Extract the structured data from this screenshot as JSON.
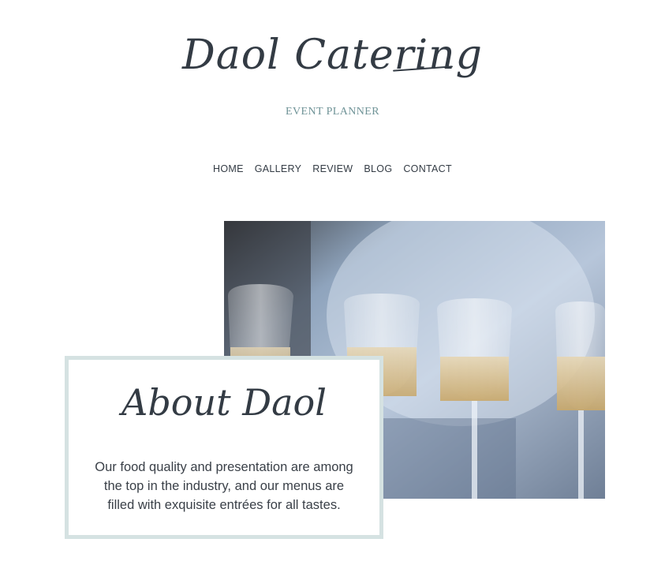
{
  "header": {
    "logo_text": "Daol Catering",
    "tagline": "EVENT PLANNER"
  },
  "nav": {
    "items": [
      {
        "label": "HOME"
      },
      {
        "label": "GALLERY"
      },
      {
        "label": "REVIEW"
      },
      {
        "label": "BLOG"
      },
      {
        "label": "CONTACT"
      }
    ]
  },
  "hero": {
    "image_description_icon": "champagne-glasses-photo"
  },
  "about": {
    "title": "About Daol",
    "body": "Our food quality and presentation are among the top in the industry, and our menus are filled with exquisite entrées for all tastes."
  },
  "colors": {
    "text": "#333b44",
    "accent": "#6f9397",
    "card_border": "#d5e2e2"
  }
}
